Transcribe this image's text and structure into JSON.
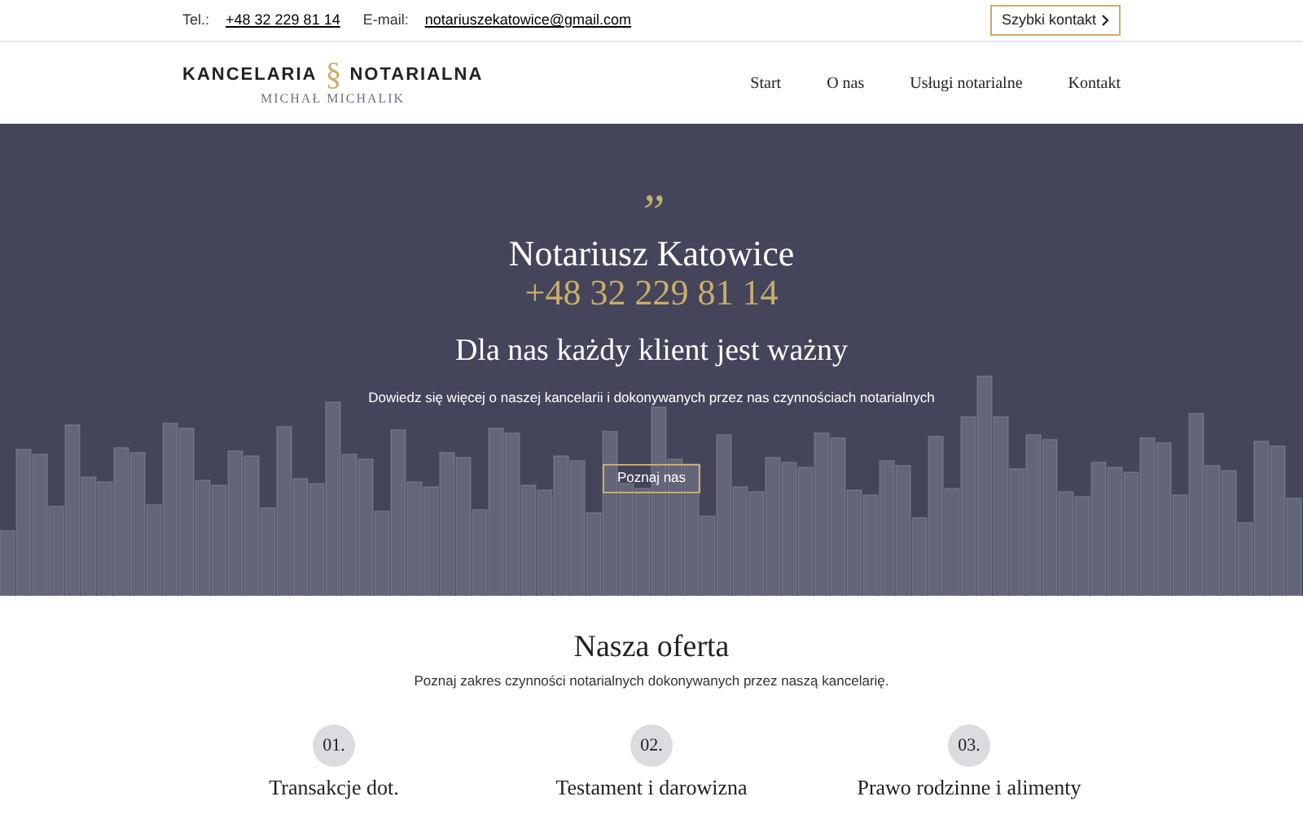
{
  "top_bar": {
    "phone_label": "Tel.:",
    "phone": "+48 32 229 81 14",
    "email_label": "E-mail:",
    "email": "notariuszekatowice@gmail.com",
    "quick_contact": "Szybki kontakt"
  },
  "logo": {
    "left": "KANCELARIA",
    "symbol": "§",
    "right": "NOTARIALNA",
    "subtitle": "MICHAŁ MICHALIK"
  },
  "nav": [
    {
      "label": "Start"
    },
    {
      "label": "O nas"
    },
    {
      "label": "Usługi notarialne"
    },
    {
      "label": "Kontakt"
    }
  ],
  "hero": {
    "quote_mark": "”",
    "title": "Notariusz Katowice",
    "phone": "+48 32 229 81 14",
    "heading": "Dla nas każdy klient jest ważny",
    "text": "Dowiedz się więcej o naszej kancelarii i dokonywanych przez nas czynnościach notarialnych",
    "button": "Poznaj nas"
  },
  "offer": {
    "title": "Nasza oferta",
    "subtitle": "Poznaj zakres czynności notarialnych dokonywanych przez naszą kancelarię.",
    "items": [
      {
        "number": "01.",
        "title": "Transakcje dot."
      },
      {
        "number": "02.",
        "title": "Testament i darowizna"
      },
      {
        "number": "03.",
        "title": "Prawo rodzinne i alimenty"
      }
    ]
  }
}
